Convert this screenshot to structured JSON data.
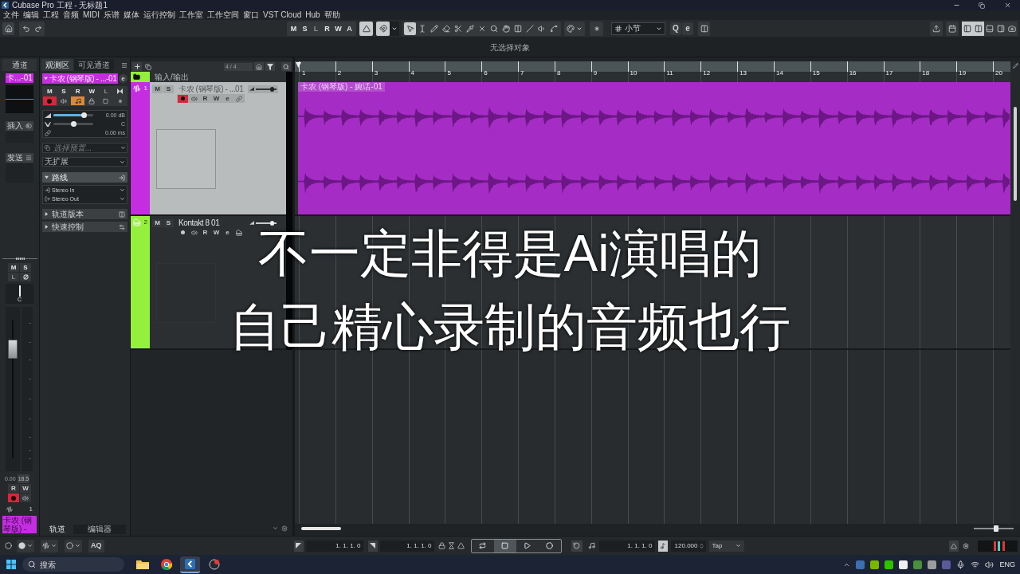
{
  "title_bar": {
    "title": "Cubase Pro 工程 - 无标题1"
  },
  "menu": [
    "文件",
    "编辑",
    "工程",
    "音频",
    "MIDI",
    "乐谱",
    "媒体",
    "运行控制",
    "工作室",
    "工作空间",
    "窗口",
    "VST Cloud",
    "Hub",
    "帮助"
  ],
  "toolbar": {
    "track_buttons": [
      {
        "label": "M",
        "disabled": false
      },
      {
        "label": "S",
        "disabled": false
      },
      {
        "label": "L",
        "disabled": true
      },
      {
        "label": "R",
        "disabled": false
      },
      {
        "label": "W",
        "disabled": false
      },
      {
        "label": "A",
        "disabled": false
      }
    ],
    "modes": [
      {
        "kind": "autoscroll",
        "on": true
      },
      {
        "kind": "snap",
        "on": true
      }
    ],
    "tools": [
      {
        "kind": "pointer",
        "selected": true
      },
      {
        "kind": "range",
        "selected": false
      },
      {
        "kind": "pencil",
        "selected": false
      },
      {
        "kind": "eraser",
        "selected": false
      },
      {
        "kind": "scissors",
        "selected": false
      },
      {
        "kind": "glue",
        "selected": false
      },
      {
        "kind": "mute",
        "selected": false
      },
      {
        "kind": "zoom",
        "selected": false
      },
      {
        "kind": "hand",
        "selected": false
      },
      {
        "kind": "comp",
        "selected": false
      },
      {
        "kind": "line",
        "selected": false
      },
      {
        "kind": "speaker",
        "selected": false
      },
      {
        "kind": "warp",
        "selected": false
      }
    ],
    "grid_type": "小节",
    "quantize_buttons": [
      "Q",
      "e"
    ],
    "layouts": [
      {
        "kind": "left",
        "on": true
      },
      {
        "kind": "inspector",
        "on": true
      },
      {
        "kind": "lower",
        "on": false
      },
      {
        "kind": "right",
        "on": false
      },
      {
        "kind": "rack",
        "on": false
      }
    ]
  },
  "info_line": "无选择对象",
  "channel_strip": {
    "tab": "通道",
    "name": "卡...-01",
    "insert": "插入",
    "send": "发送",
    "buttons": [
      {
        "label": "M",
        "disabled": false
      },
      {
        "label": "S",
        "disabled": false
      },
      {
        "label": "L",
        "disabled": true
      }
    ],
    "pan": {
      "level": 0.5,
      "reading": "C"
    },
    "fader": {
      "level": 0.79
    },
    "volume": "0.00",
    "peak": "18.5",
    "automation": [
      "R",
      "W"
    ],
    "record_enabled": true,
    "number": "1",
    "track_name": "卡农 (钢琴版) -"
  },
  "inspector": {
    "tabs": [
      {
        "label": "观测区",
        "selected": true
      },
      {
        "label": "可见通道",
        "selected": false
      }
    ],
    "track": {
      "name": "卡农 (钢琴版) - ...-01",
      "expanded": true,
      "edit": "e"
    },
    "buttons": [
      {
        "label": "M",
        "disabled": false
      },
      {
        "label": "S",
        "disabled": false
      },
      {
        "label": "R",
        "disabled": false
      },
      {
        "label": "W",
        "disabled": false
      },
      {
        "label": "L",
        "disabled": true
      }
    ],
    "record_enabled": true,
    "timebase_musical": true,
    "volume": {
      "level": 0.75,
      "reading": "0.00 dB"
    },
    "pan": {
      "level": 0.5,
      "reading": "C"
    },
    "delay": "0.00 ms",
    "preset_placeholder": "选择预置...",
    "expansion": "无扩展",
    "sections": [
      {
        "kind": "routing",
        "label": "路线",
        "expanded": true,
        "items": [
          {
            "kind": "input",
            "label": "Stereo In"
          },
          {
            "kind": "output",
            "label": "Stereo Out"
          }
        ]
      },
      {
        "kind": "versions",
        "label": "轨道版本",
        "expanded": false
      },
      {
        "kind": "quick_controls",
        "label": "快速控制",
        "expanded": false
      }
    ]
  },
  "track_list": {
    "signature": "4 / 4",
    "tracks": [
      {
        "kind": "folder",
        "name": "输入/输出",
        "color": "#94f03c",
        "selected": false
      },
      {
        "kind": "audio",
        "number": "1",
        "name": "卡农 (钢琴版) - ...01",
        "color": "#c42ee0",
        "selected": true,
        "record_enabled": true,
        "mute_solo": [
          "M",
          "S"
        ],
        "row_buttons": [
          "R",
          "W",
          "e"
        ],
        "volume": {
          "level": 0.77
        },
        "events": [
          {
            "name": "卡农 (钢琴版) - 婉话-01",
            "color": "#a52dc5"
          }
        ]
      },
      {
        "kind": "instrument",
        "number": "2",
        "name": "Kontakt 8 01",
        "color": "#94f03c",
        "selected": false,
        "record_enabled": false,
        "mute_solo": [
          "M",
          "S"
        ],
        "row_buttons": [
          "R",
          "W",
          "e"
        ],
        "volume": {
          "level": 0.77
        }
      }
    ]
  },
  "project": {
    "ruler": [
      "1",
      "2",
      "3",
      "4",
      "5",
      "6",
      "7",
      "8",
      "9",
      "10",
      "11",
      "12",
      "13",
      "14",
      "15",
      "16",
      "17",
      "18",
      "19",
      "20"
    ],
    "zoom": {
      "level": 0.55
    }
  },
  "subtitles": [
    "不一定非得是Ai演唱的",
    "自己精心录制的音频也行"
  ],
  "bottom_tabs": [
    {
      "label": "轨道",
      "selected": true
    },
    {
      "label": "编辑器",
      "selected": false
    }
  ],
  "transport": {
    "aq": "AQ",
    "left_locator": "1. 1. 1. 0",
    "right_locator": "1. 1. 1. 0",
    "buttons": [
      {
        "kind": "cycle",
        "on": false
      },
      {
        "kind": "stop",
        "on": true
      },
      {
        "kind": "play",
        "on": false
      },
      {
        "kind": "record",
        "on": false
      }
    ],
    "position": "1. 1. 1. 0",
    "tempo": "120.000",
    "tap": "Tap"
  },
  "taskbar": {
    "search_placeholder": "搜索",
    "apps": [
      {
        "kind": "files",
        "selected": false
      },
      {
        "kind": "browser",
        "selected": false
      },
      {
        "kind": "daw",
        "selected": true
      },
      {
        "kind": "recorder",
        "selected": false
      }
    ],
    "language": "ENG"
  }
}
